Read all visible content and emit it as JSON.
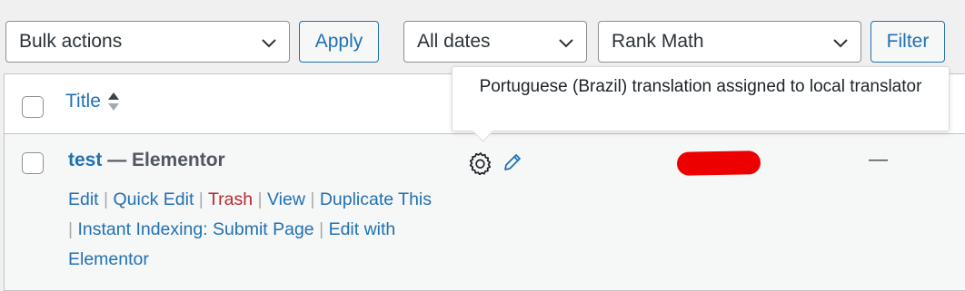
{
  "toolbar": {
    "bulk_actions": "Bulk actions",
    "apply": "Apply",
    "dates": "All dates",
    "seo_filter": "Rank Math",
    "filter": "Filter"
  },
  "table": {
    "columns": {
      "title": "Title"
    }
  },
  "row": {
    "title": "test",
    "state": " — Elementor",
    "actions": [
      "Edit",
      "Quick Edit",
      "Trash",
      "View",
      "Duplicate This",
      "Instant Indexing: Submit Page",
      "Edit with Elementor"
    ],
    "empty_cell": "—"
  },
  "tooltip": {
    "text": "Portuguese (Brazil) translation assigned to local translator"
  },
  "colors": {
    "link": "#2271b1",
    "trash": "#b32d2e",
    "redaction": "#ec0000"
  },
  "icons": [
    "chevron-down-icon",
    "sort-arrows-icon",
    "gear-icon",
    "pencil-icon"
  ]
}
